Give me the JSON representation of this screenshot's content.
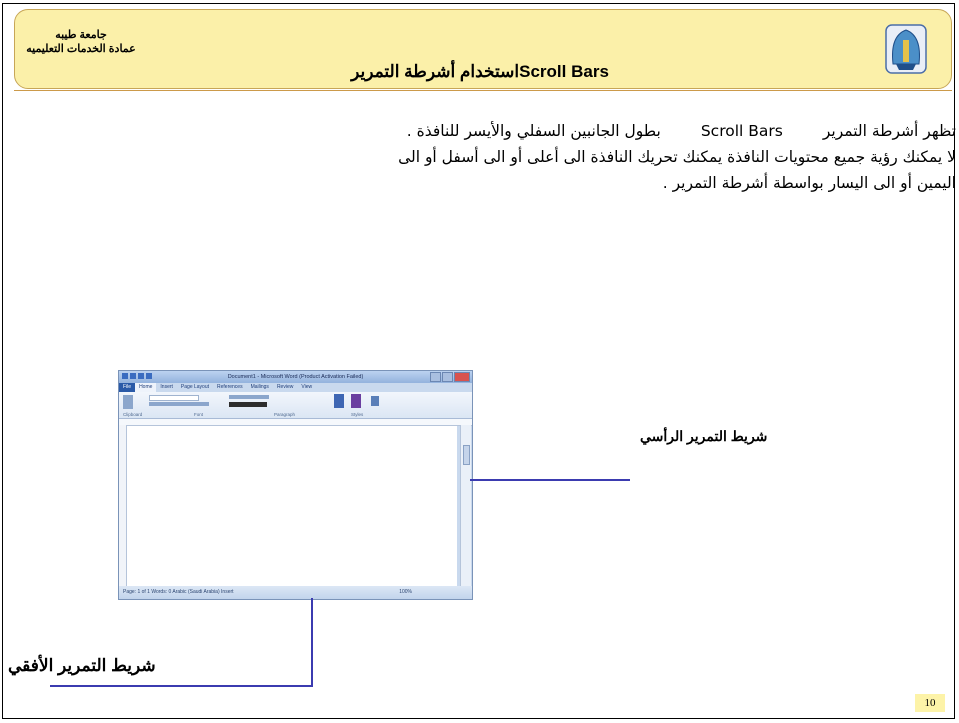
{
  "header": {
    "university": "جامعة طيبه",
    "deanship": "عمادة الخدمات التعليميه",
    "title_en": "Scroll Bars",
    "title_ar": "استخدام أشرطة التمرير"
  },
  "body": {
    "line1_start": "تظهر أشرطة التمرير",
    "line1_term": "Scroll Bars",
    "line1_end": "بطول الجانبين السفلي والأيسر للنافذة .",
    "line2": "لا يمكنك رؤية جميع محتويات النافذة يمكنك تحريك النافذة الى أعلى أو الى أسفل أو الى",
    "line3": "اليمين أو الى اليسار بواسطة أشرطة التمرير ."
  },
  "labels": {
    "vertical": "شريط التمرير الرأسي",
    "horizontal": "شريط التمرير الأفقي"
  },
  "screenshot": {
    "window_title": "Document1 - Microsoft Word (Product Activation Failed)",
    "tabs": [
      "File",
      "Home",
      "Insert",
      "Page Layout",
      "References",
      "Mailings",
      "Review",
      "View"
    ],
    "groups": [
      "Clipboard",
      "Font",
      "Paragraph",
      "Styles"
    ],
    "status": "Page: 1 of 1   Words: 0   Arabic (Saudi Arabia)   Insert",
    "zoom": "100%"
  },
  "page_number": "10",
  "colors": {
    "header_fill": "#fbf0a9",
    "header_border": "#c7a657",
    "pointer_line": "#3b3bb0"
  }
}
